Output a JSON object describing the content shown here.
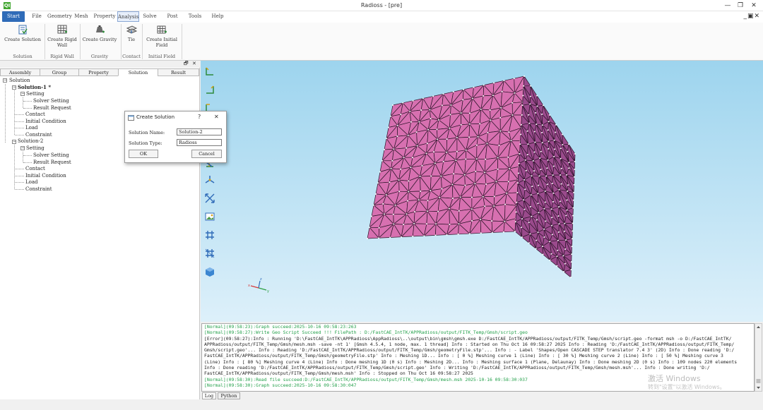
{
  "app": {
    "title": "Radioss - [pre]",
    "icon_text": "QI"
  },
  "window_controls": {
    "minimize": "—",
    "maximize": "❐",
    "close": "✕"
  },
  "mdi_controls": "_▣✕",
  "menu": [
    "Start",
    "File",
    "Geometry",
    "Mesh",
    "Property",
    "Analysis",
    "Solve",
    "Post",
    "Tools",
    "Help"
  ],
  "ribbon": {
    "buttons": [
      {
        "label1": "Create Solution",
        "label2": "",
        "icon": "create-solution-icon"
      },
      {
        "label1": "Create Rigid",
        "label2": "Wall",
        "icon": "rigid-wall-icon"
      },
      {
        "label1": "Create Gravity",
        "label2": "",
        "icon": "gravity-icon"
      },
      {
        "label1": "Tie",
        "label2": "",
        "icon": "tie-icon"
      },
      {
        "label1": "Create Initial",
        "label2": "Field",
        "icon": "initial-field-icon"
      }
    ],
    "groups": [
      "Solution",
      "Rigid Wall",
      "Gravity",
      "Contact",
      "Initial Field"
    ]
  },
  "left_panel": {
    "float_btn": "🗗",
    "close_btn": "✕",
    "tabs": [
      "Assembly",
      "Group",
      "Property",
      "Solution",
      "Result"
    ],
    "tree": {
      "root": "Solution",
      "solution1": "Solution-1 *",
      "setting": "Setting",
      "solver_setting": "Solver Setting",
      "result_request": "Result Request",
      "contact": "Contact",
      "initial_condition": "Initial Condition",
      "load": "Load",
      "constraint": "Constraint",
      "solution2": "Solution-2"
    }
  },
  "dialog": {
    "title": "Create Solution",
    "help": "?",
    "close": "✕",
    "name_label": "Solution Name:",
    "name_value": "Solution-2",
    "type_label": "Solution Type:",
    "type_value": "Radioss",
    "ok": "OK",
    "cancel": "Cancel"
  },
  "console": {
    "lines": [
      {
        "type": "ok",
        "text": "[Normal](09:58:23):Graph succeed:2025-10-16 09:58:23:263"
      },
      {
        "type": "ok",
        "text": "[Normal](09:58:27):Write Geo Script Succeed !!! FilePath : D:/FastCAE_IntTK/APPRadioss/output/FITK_Temp/Gmsh/script.geo"
      },
      {
        "type": "err",
        "text": "[Error](09:58:27):Info : Running 'D:\\FastCAE_IntTK\\APPRadioss\\AppRadioss\\..\\output\\bin\\gmsh\\gmsh.exe D:/FastCAE_IntTK/APPRadioss/output/FITK_Temp/Gmsh/script.geo -format msh -o D:/FastCAE_IntTK/"
      },
      {
        "type": "err",
        "text": "APPRadioss/output/FITK_Temp/Gmsh/mesh.msh -save -nt 1' [Gmsh 4.5.4, 1 node, max. 1 thread] Info : Started on Thu Oct 16 09:58:27 2025 Info : Reading 'D:/FastCAE_IntTK/APPRadioss/output/FITK_Temp/"
      },
      {
        "type": "err",
        "text": "Gmsh/script.geo'... Info : Reading 'D:/FastCAE_IntTK/APPRadioss/output/FITK_Temp/Gmsh/geometryFile.stp'... Info : - Label 'Shapes/Open CASCADE STEP translator 7.4 3' (2D) Info : Done reading 'D:/"
      },
      {
        "type": "err",
        "text": "FastCAE_IntTK/APPRadioss/output/FITK_Temp/Gmsh/geometryFile.stp' Info : Meshing 1D... Info : [ 0 %] Meshing curve 1 (Line) Info : [ 30 %] Meshing curve 2 (Line) Info : [ 50 %] Meshing curve 3"
      },
      {
        "type": "err",
        "text": "(Line) Info : [ 80 %] Meshing curve 4 (Line) Info : Done meshing 1D (0 s) Info : Meshing 2D... Info : Meshing surface 1 (Plane, Delaunay) Info : Done meshing 2D (0 s) Info : 109 nodes 220 elements"
      },
      {
        "type": "err",
        "text": "Info : Done reading 'D:/FastCAE_IntTK/APPRadioss/output/FITK_Temp/Gmsh/script.geo' Info : Writing 'D:/FastCAE_IntTK/APPRadioss/output/FITK_Temp/Gmsh/mesh.msh'... Info : Done writing 'D:/"
      },
      {
        "type": "err",
        "text": "FastCAE_IntTK/APPRadioss/output/FITK_Temp/Gmsh/mesh.msh' Info : Stopped on Thu Oct 16 09:58:27 2025"
      },
      {
        "type": "ok",
        "text": "[Normal](09:58:30):Read file succeed:D:/FastCAE_IntTK/APPRadioss/output/FITK_Temp/Gmsh/mesh.msh 2025-10-16 09:58:30:037"
      },
      {
        "type": "ok",
        "text": "[Normal](09:58:30):Graph succeed:2025-10-16 09:58:30:047"
      }
    ],
    "tabs": [
      "Log",
      "Python"
    ]
  },
  "watermark": {
    "line1": "激活 Windows",
    "line2": "转到\"设置\"以激活 Windows。"
  },
  "colors": {
    "accent": "#2f6bb8",
    "mesh_front": "#d770b0",
    "mesh_side": "#9a4a8c",
    "viewport_top": "#9dd4ee",
    "log_ok": "#23a04a"
  }
}
